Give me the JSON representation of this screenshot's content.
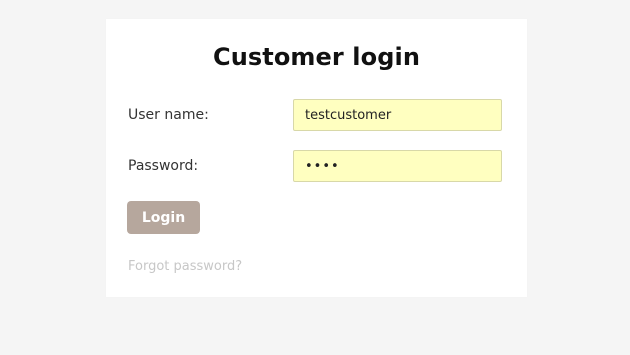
{
  "login": {
    "title": "Customer login",
    "username_label": "User name:",
    "username_value": "testcustomer",
    "password_label": "Password:",
    "password_value": "••••",
    "login_button": "Login",
    "forgot_link": "Forgot password?"
  },
  "colors": {
    "page_background": "#f5f5f5",
    "card_background": "#ffffff",
    "input_autofill": "#ffffc0",
    "button_background": "#b6a79d",
    "link_text": "#c7c7c7"
  }
}
